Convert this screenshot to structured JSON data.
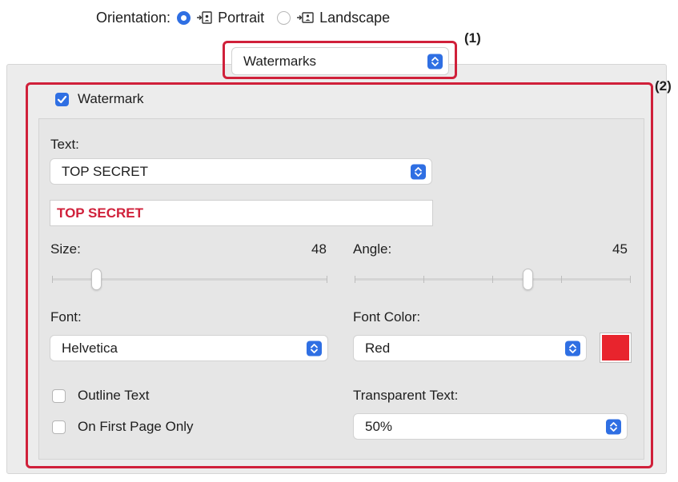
{
  "orientation": {
    "label": "Orientation:",
    "portrait_label": "Portrait",
    "landscape_label": "Landscape",
    "selected": "Portrait"
  },
  "callouts": {
    "one": "(1)",
    "two": "(2)"
  },
  "panel_popup": {
    "value": "Watermarks"
  },
  "watermark": {
    "enabled_label": "Watermark",
    "enabled": true,
    "text_label": "Text:",
    "text_select_value": "TOP SECRET",
    "text_field_value": "TOP SECRET",
    "size_label": "Size:",
    "size_value": "48",
    "size_fraction": 0.16,
    "angle_label": "Angle:",
    "angle_value": "45",
    "angle_fraction": 0.625,
    "font_label": "Font:",
    "font_value": "Helvetica",
    "font_color_label": "Font Color:",
    "font_color_value": "Red",
    "font_color_hex": "#e8242d",
    "outline_label": "Outline Text",
    "outline_checked": false,
    "first_page_label": "On First Page Only",
    "first_page_checked": false,
    "transparent_label": "Transparent Text:",
    "transparent_value": "50%"
  },
  "colors": {
    "accent": "#2f6fe3",
    "callout": "#d0203a"
  }
}
